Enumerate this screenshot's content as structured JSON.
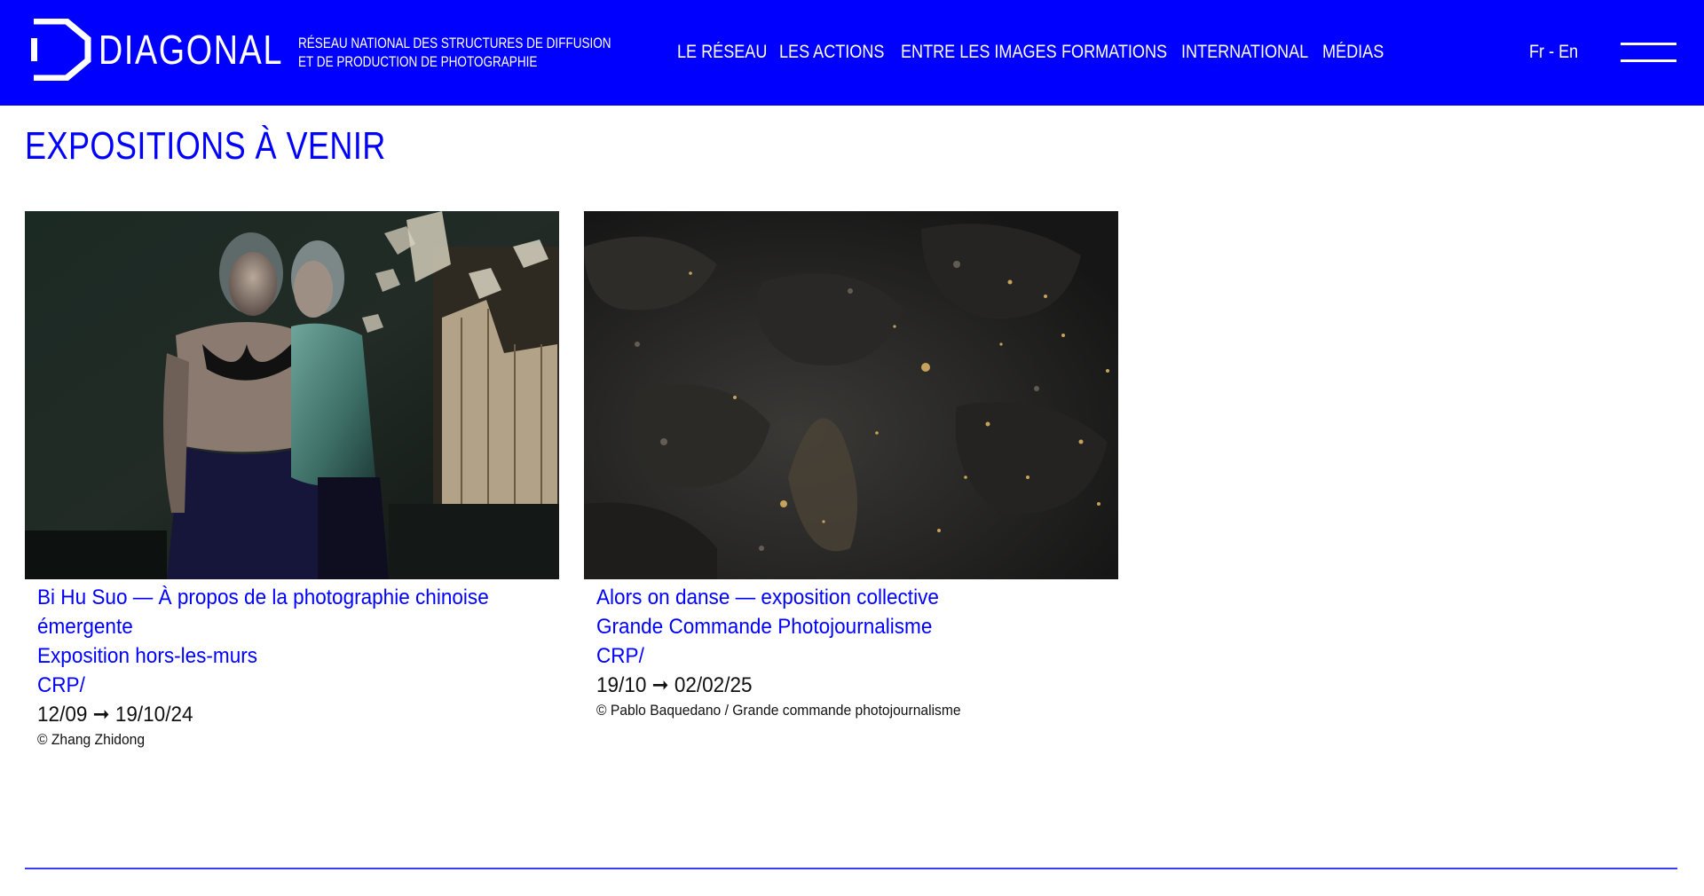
{
  "colors": {
    "brand": "#0000ff",
    "text": "#111111",
    "background": "#ffffff"
  },
  "header": {
    "logo_text": "DIAGONAL",
    "tagline_line1": "Réseau national des structures de diffusion",
    "tagline_line2": "et de production de photographie",
    "nav": [
      {
        "label": "Le Réseau"
      },
      {
        "label": "Les actions"
      },
      {
        "label": "Entre les images"
      },
      {
        "label": "Formations"
      },
      {
        "label": "International"
      },
      {
        "label": "Médias"
      }
    ],
    "lang_fr": "Fr",
    "lang_sep": " - ",
    "lang_en": "En",
    "menu_icon": "hamburger-icon"
  },
  "main": {
    "title": "Expositions à venir",
    "cards": [
      {
        "title": "Bi Hu Suo — À propos de la photographie chinoise émergente",
        "line": "Exposition hors-les-murs",
        "venue": "CRP/",
        "dates": "12/09 ➞ 19/10/24",
        "credit": "© Zhang Zhidong"
      },
      {
        "title": "Alors on danse — exposition collective",
        "line": "Grande Commande Photojournalisme",
        "venue": "CRP/",
        "dates": "19/10 ➞ 02/02/25",
        "credit": "© Pablo Baquedano / Grande commande photojournalisme"
      }
    ]
  }
}
